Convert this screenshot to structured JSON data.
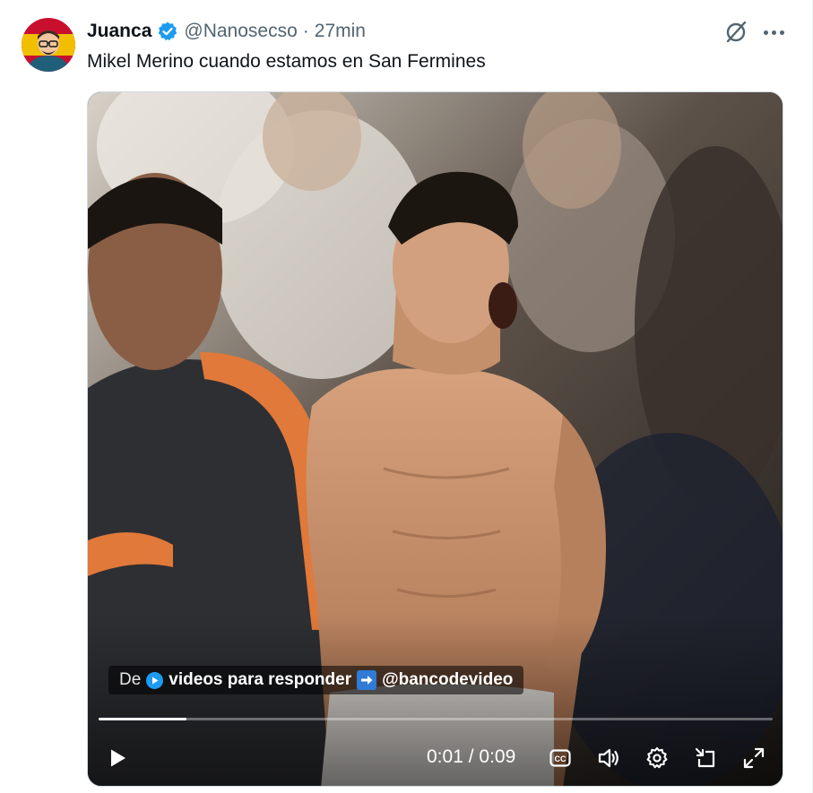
{
  "user": {
    "name": "Juanca",
    "handle": "@Nanosecso",
    "separator": "·",
    "time": "27min",
    "verified": true
  },
  "tweet": {
    "text": "Mikel Merino cuando estamos en San Fermines"
  },
  "video": {
    "caption": {
      "prefix": "De",
      "source": "videos para responder",
      "credit": "@bancodevideo"
    },
    "current_time": "0:01",
    "time_separator": "/",
    "duration": "0:09",
    "progress": 0.13
  },
  "icons": {
    "verified": "verified-badge-icon",
    "grok": "grok-icon",
    "more": "more-icon",
    "play": "play-icon",
    "captions": "captions-icon",
    "volume": "volume-icon",
    "settings": "settings-icon",
    "pip": "picture-in-picture-icon",
    "fullscreen": "fullscreen-icon"
  },
  "colors": {
    "accent": "#1d9bf0",
    "text_primary": "#0f1419",
    "text_secondary": "#536471"
  }
}
